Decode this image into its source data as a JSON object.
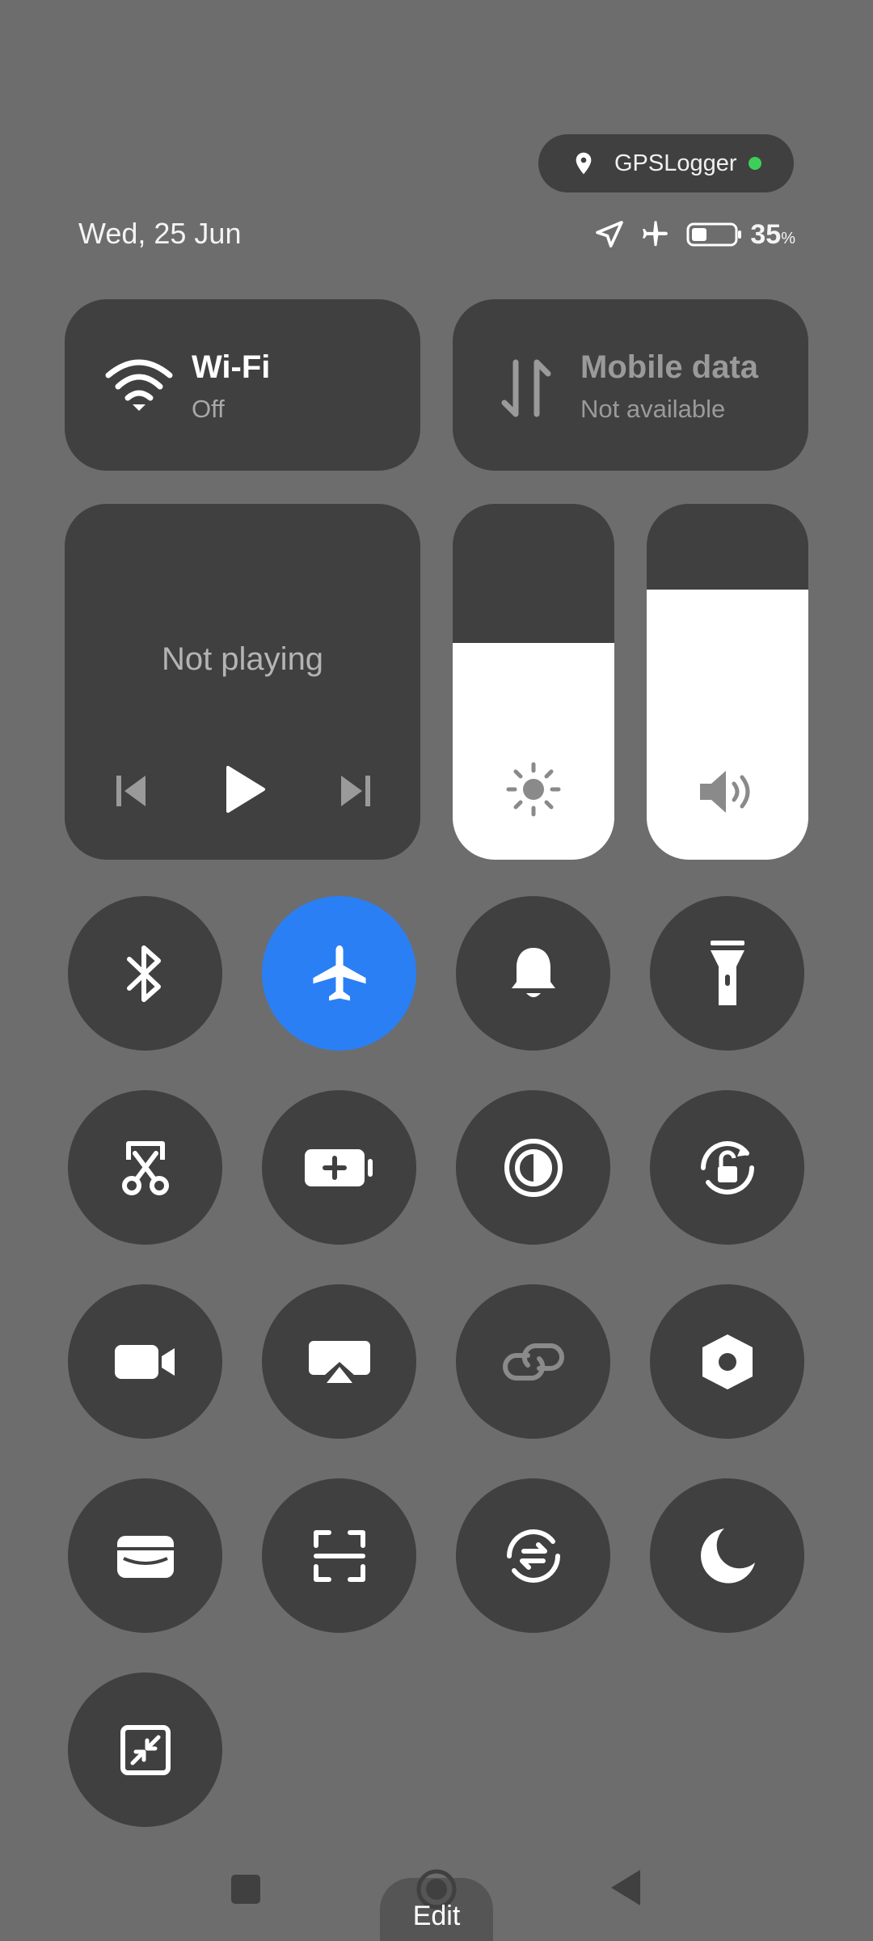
{
  "location_pill": {
    "app_name": "GPSLogger",
    "indicator_color": "#3ecf5a"
  },
  "status_bar": {
    "date": "Wed, 25 Jun",
    "battery_percent": "35",
    "battery_unit": "%"
  },
  "wifi": {
    "title": "Wi-Fi",
    "state": "Off"
  },
  "mobile_data": {
    "title": "Mobile data",
    "state": "Not available"
  },
  "media": {
    "status": "Not playing"
  },
  "sliders": {
    "brightness_level": 0.61,
    "volume_level": 0.76
  },
  "tiles": [
    {
      "icon": "bluetooth-icon",
      "active": false
    },
    {
      "icon": "airplane-icon",
      "active": true
    },
    {
      "icon": "bell-icon",
      "active": false
    },
    {
      "icon": "flashlight-icon",
      "active": false
    },
    {
      "icon": "screenshot-icon",
      "active": false
    },
    {
      "icon": "battery-saver-icon",
      "active": false
    },
    {
      "icon": "dark-mode-icon",
      "active": false
    },
    {
      "icon": "auto-rotate-icon",
      "active": false
    },
    {
      "icon": "screen-record-icon",
      "active": false
    },
    {
      "icon": "screencast-icon",
      "active": false
    },
    {
      "icon": "link-icon",
      "active": false
    },
    {
      "icon": "settings-icon",
      "active": false
    },
    {
      "icon": "wallet-icon",
      "active": false
    },
    {
      "icon": "scanner-icon",
      "active": false
    },
    {
      "icon": "sync-icon",
      "active": false
    },
    {
      "icon": "moon-icon",
      "active": false
    },
    {
      "icon": "resize-icon",
      "active": false
    }
  ],
  "accent_color": "#2a7ff5",
  "bottom": {
    "edit_label": "Edit"
  }
}
